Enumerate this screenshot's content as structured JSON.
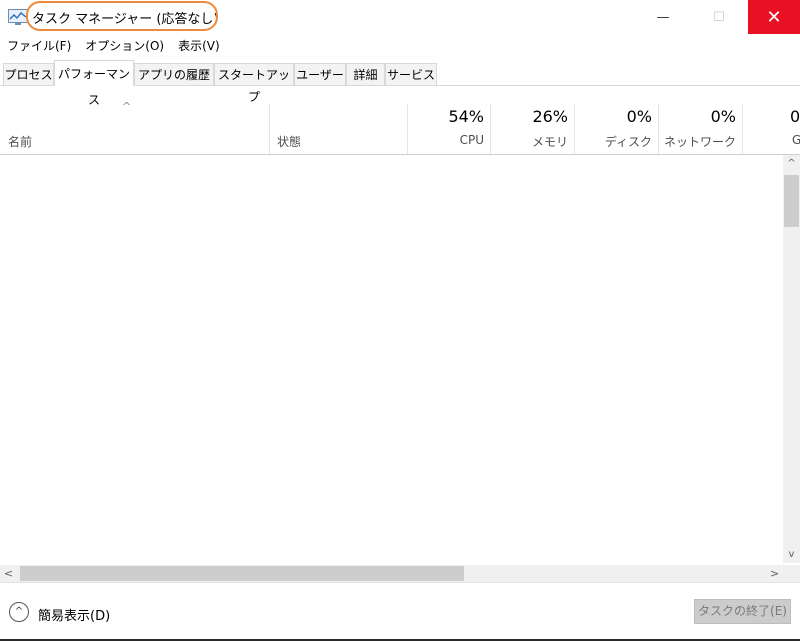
{
  "window": {
    "title": "タスク マネージャー (応答なし)",
    "minimize_icon": "—",
    "maximize_icon": "☐",
    "close_icon": "✕"
  },
  "menu": {
    "items": [
      "ファイル(F)",
      "オプション(O)",
      "表示(V)"
    ]
  },
  "tabs": {
    "items": [
      "プロセス",
      "パフォーマンス",
      "アプリの履歴",
      "スタートアップ",
      "ユーザー",
      "詳細",
      "サービス"
    ],
    "active_index": 1
  },
  "table": {
    "sort_caret": "^",
    "columns": {
      "name": "名前",
      "status": "状態",
      "cpu": {
        "pct": "54%",
        "label": "CPU"
      },
      "memory": {
        "pct": "26%",
        "label": "メモリ"
      },
      "disk": {
        "pct": "0%",
        "label": "ディスク"
      },
      "network": {
        "pct": "0%",
        "label": "ネットワーク"
      },
      "gpu": {
        "pct": "0",
        "label": "G"
      }
    }
  },
  "scroll": {
    "up": "^",
    "down": "v",
    "left": "<",
    "right": ">"
  },
  "footer": {
    "fewer_icon": "^",
    "fewer_label": "簡易表示(D)",
    "end_task_label": "タスクの終了(E)"
  },
  "colors": {
    "title_highlight": "#ef8a3a",
    "close_button": "#e81123"
  }
}
